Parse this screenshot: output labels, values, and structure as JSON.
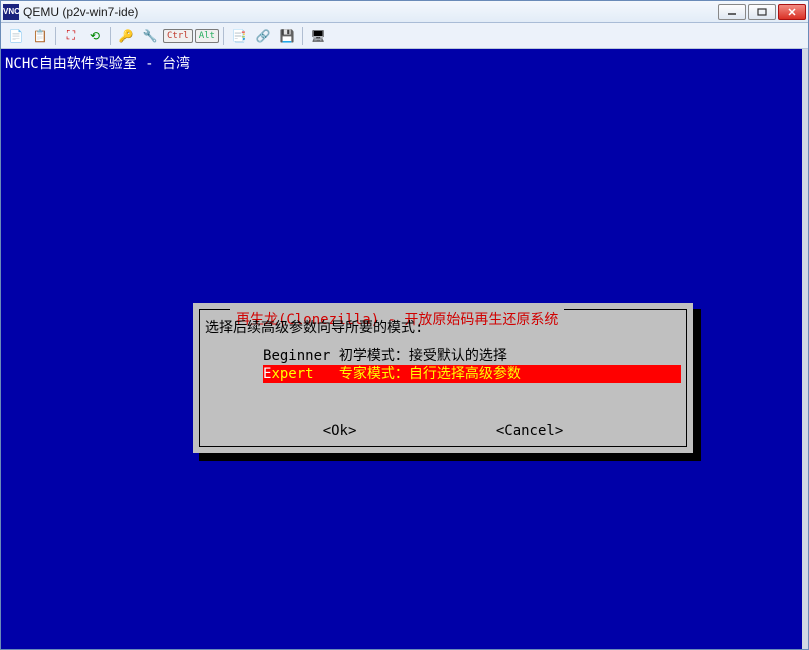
{
  "window": {
    "app_icon_text": "VNC",
    "title": "QEMU (p2v-win7-ide)"
  },
  "toolbar": {
    "new_icon": "📄",
    "clipboard_icon": "📋",
    "fit_icon": "⛶",
    "refresh_icon": "⟲",
    "key_icon": "🔑",
    "wrench_icon": "🔧",
    "ctrl_label": "Ctrl",
    "alt_label": "Alt",
    "copy_icon": "📑",
    "link_icon": "🔗",
    "save_icon": "💾",
    "display_icon": "🖥"
  },
  "console": {
    "top_label": "NCHC自由软件实验室 - 台湾"
  },
  "dialog": {
    "title": "再生龙(Clonezilla) - 开放原始码再生还原系统",
    "prompt": "选择后续高级参数向导所要的模式:",
    "options": [
      {
        "key": "Beginner",
        "label": "初学模式：接受默认的选择",
        "selected": false
      },
      {
        "key": "Expert  ",
        "label": "专家模式：自行选择高级参数",
        "selected": true
      }
    ],
    "ok_label": "<Ok>",
    "cancel_label": "<Cancel>"
  }
}
